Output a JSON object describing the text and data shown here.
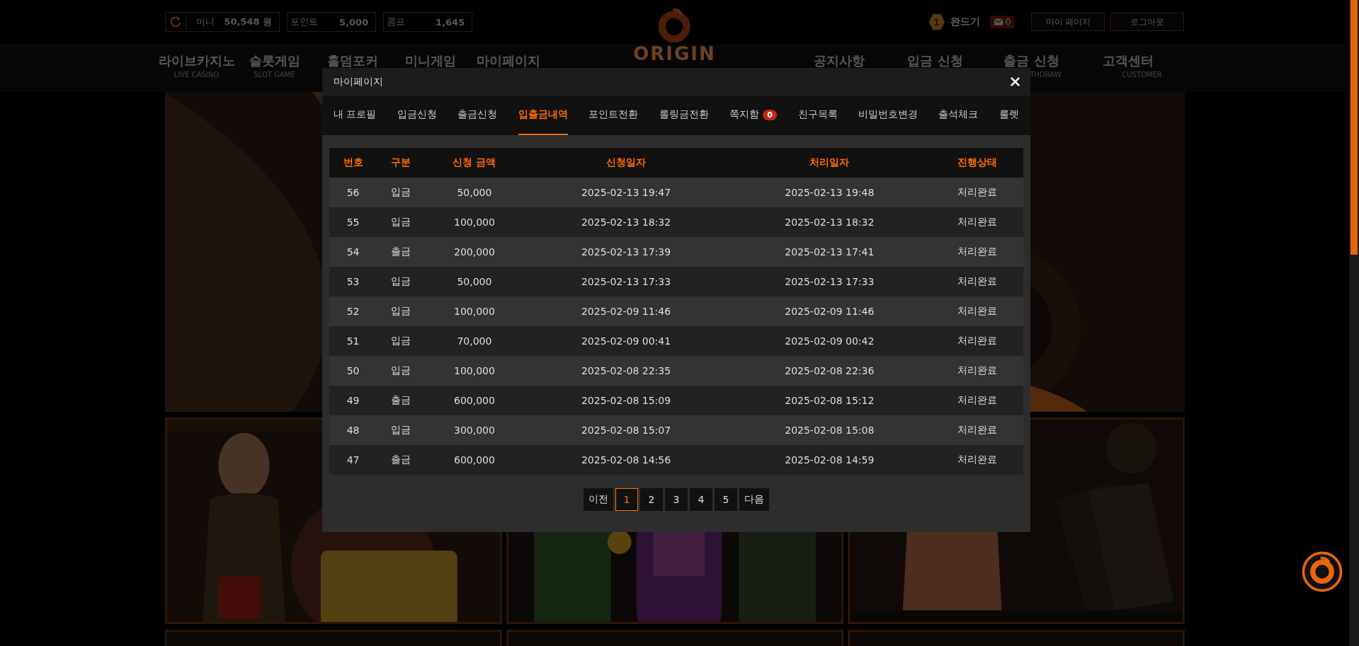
{
  "top_bar": {
    "balances": [
      {
        "label": "머니",
        "value": "50,548 원",
        "refresh": true
      },
      {
        "label": "포인트",
        "value": "5,000",
        "refresh": false
      },
      {
        "label": "콤프",
        "value": "1,645",
        "refresh": false
      }
    ],
    "logo": {
      "text": "ORIGIN"
    },
    "user": {
      "level": "1",
      "name": "완드기",
      "messages": "0"
    },
    "buttons": [
      "마이 페이지",
      "로그아웃"
    ]
  },
  "nav": {
    "left": [
      {
        "label": "라이브카지노",
        "sub": "LIVE CASINO"
      },
      {
        "label": "슬롯게임",
        "sub": "SLOT GAME"
      },
      {
        "label": "홀덤포커"
      },
      {
        "label": "미니게임"
      },
      {
        "label": "마이페이지"
      }
    ],
    "right": [
      {
        "label": "공지사항"
      },
      {
        "label": "입금 신청"
      },
      {
        "label": "출금 신청",
        "sub": "THDRAW"
      },
      {
        "label": "고객센터",
        "sub": "CUSTOMER"
      }
    ]
  },
  "modal": {
    "title": "마이페이지",
    "tabs": [
      {
        "label": "내 프로필",
        "selected": false
      },
      {
        "label": "입금신청",
        "selected": false
      },
      {
        "label": "출금신청",
        "selected": false
      },
      {
        "label": "입출금내역",
        "selected": true
      },
      {
        "label": "포인트전환",
        "selected": false
      },
      {
        "label": "롤링금전환",
        "selected": false
      },
      {
        "label": "쪽지함",
        "selected": false,
        "badge": "0"
      },
      {
        "label": "친구목록",
        "selected": false
      },
      {
        "label": "비밀번호변경",
        "selected": false
      },
      {
        "label": "출석체크",
        "selected": false
      },
      {
        "label": "룰렛",
        "selected": false
      }
    ],
    "table": {
      "columns": [
        "번호",
        "구분",
        "신청 금액",
        "신청일자",
        "처리일자",
        "진행상태"
      ],
      "rows": [
        [
          "56",
          "입금",
          "50,000",
          "2025-02-13 19:47",
          "2025-02-13 19:48",
          "처리완료"
        ],
        [
          "55",
          "입금",
          "100,000",
          "2025-02-13 18:32",
          "2025-02-13 18:32",
          "처리완료"
        ],
        [
          "54",
          "출금",
          "200,000",
          "2025-02-13 17:39",
          "2025-02-13 17:41",
          "처리완료"
        ],
        [
          "53",
          "입금",
          "50,000",
          "2025-02-13 17:33",
          "2025-02-13 17:33",
          "처리완료"
        ],
        [
          "52",
          "입금",
          "100,000",
          "2025-02-09 11:46",
          "2025-02-09 11:46",
          "처리완료"
        ],
        [
          "51",
          "입금",
          "70,000",
          "2025-02-09 00:41",
          "2025-02-09 00:42",
          "처리완료"
        ],
        [
          "50",
          "입금",
          "100,000",
          "2025-02-08 22:35",
          "2025-02-08 22:36",
          "처리완료"
        ],
        [
          "49",
          "출금",
          "600,000",
          "2025-02-08 15:09",
          "2025-02-08 15:12",
          "처리완료"
        ],
        [
          "48",
          "입금",
          "300,000",
          "2025-02-08 15:07",
          "2025-02-08 15:08",
          "처리완료"
        ],
        [
          "47",
          "출금",
          "600,000",
          "2025-02-08 14:56",
          "2025-02-08 14:59",
          "처리완료"
        ]
      ]
    },
    "pagination": {
      "prev": "이전",
      "pages": [
        {
          "label": "1",
          "selected": true
        },
        {
          "label": "2",
          "selected": false
        },
        {
          "label": "3",
          "selected": false
        },
        {
          "label": "4",
          "selected": false
        },
        {
          "label": "5",
          "selected": false
        }
      ],
      "next": "다음"
    }
  }
}
